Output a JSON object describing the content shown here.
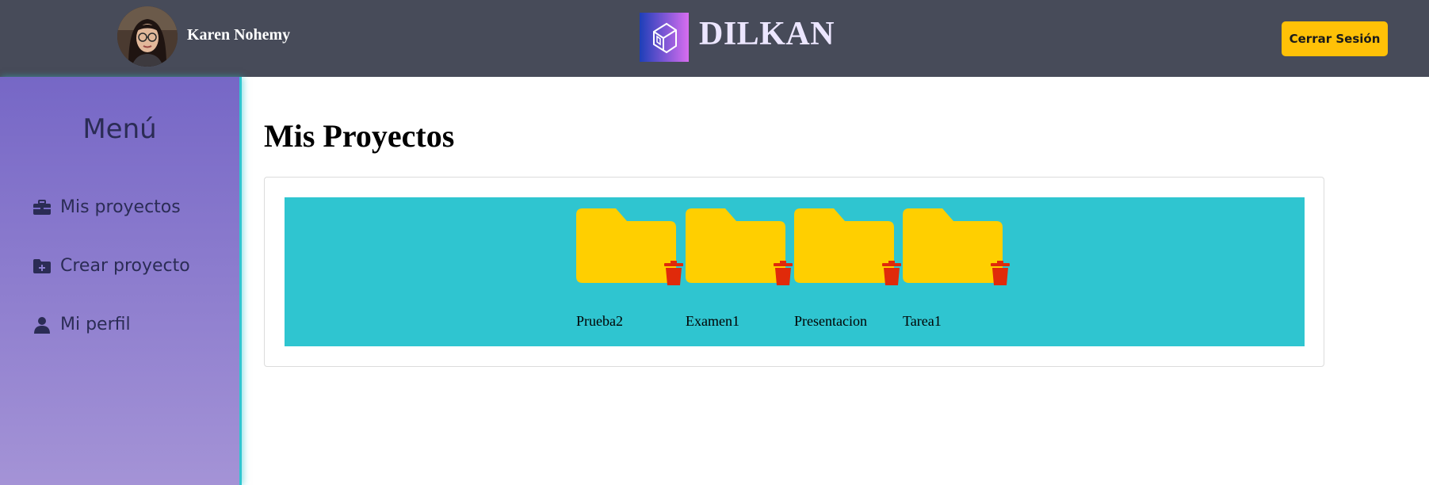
{
  "header": {
    "user_name": "Karen Nohemy",
    "brand": "DILKAN",
    "logout_label": "Cerrar Sesión"
  },
  "sidebar": {
    "title": "Menú",
    "items": [
      {
        "label": "Mis proyectos",
        "icon": "briefcase-icon"
      },
      {
        "label": "Crear proyecto",
        "icon": "folder-plus-icon"
      },
      {
        "label": "Mi perfil",
        "icon": "user-icon"
      }
    ]
  },
  "main": {
    "title": "Mis Proyectos",
    "projects": [
      {
        "name": "Prueba2",
        "icon": "folder-icon",
        "action_icon": "trash-icon"
      },
      {
        "name": "Examen1",
        "icon": "folder-icon",
        "action_icon": "trash-icon"
      },
      {
        "name": "Presentacion",
        "icon": "folder-icon",
        "action_icon": "trash-icon"
      },
      {
        "name": "Tarea1",
        "icon": "folder-icon",
        "action_icon": "trash-icon"
      }
    ]
  },
  "colors": {
    "header_bg": "#474b59",
    "accent_button": "#ffc107",
    "sidebar_gradient_top": "#7667c6",
    "sidebar_gradient_bottom": "#a493d6",
    "panel_bg": "#2fc5d0",
    "folder": "#ffcf00",
    "trash": "#e02a0a"
  }
}
